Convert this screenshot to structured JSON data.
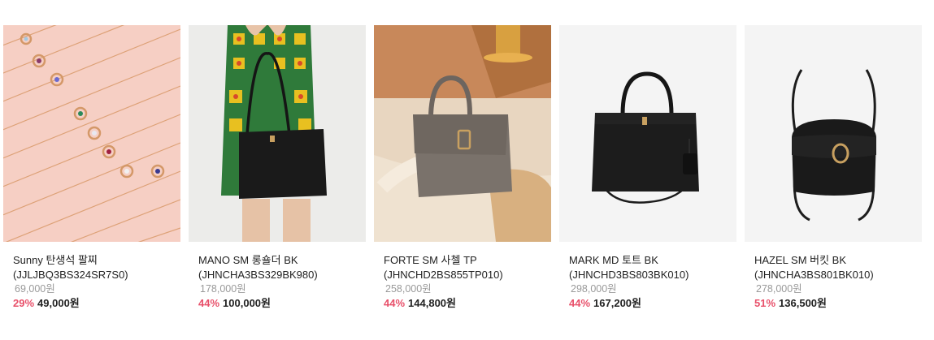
{
  "products": [
    {
      "name": "Sunny 탄생석 팔찌",
      "code": "(JJLJBQ3BS324SR7S0)",
      "original_price": "69,000원",
      "discount": "29%",
      "sale_price": "49,000원",
      "image": "rose-gold-bracelets-image"
    },
    {
      "name": "MANO SM 롱숄더 BK",
      "code": "(JHNCHA3BS329BK980)",
      "original_price": "178,000원",
      "discount": "44%",
      "sale_price": "100,000원",
      "image": "model-holding-black-shoulder-bag-image"
    },
    {
      "name": "FORTE SM 사첼 TP",
      "code": "(JHNCHD2BS855TP010)",
      "original_price": "258,000원",
      "discount": "44%",
      "sale_price": "144,800원",
      "image": "taupe-satchel-on-table-image"
    },
    {
      "name": "MARK MD 토트 BK",
      "code": "(JHNCHD3BS803BK010)",
      "original_price": "298,000원",
      "discount": "44%",
      "sale_price": "167,200원",
      "image": "black-tote-bag-image"
    },
    {
      "name": "HAZEL SM 버킷 BK",
      "code": "(JHNCHA3BS801BK010)",
      "original_price": "278,000원",
      "discount": "51%",
      "sale_price": "136,500원",
      "image": "black-bucket-bag-image"
    }
  ],
  "colors": {
    "discount": "#e8506a",
    "original_price": "#9a9a9a",
    "text": "#222222"
  }
}
